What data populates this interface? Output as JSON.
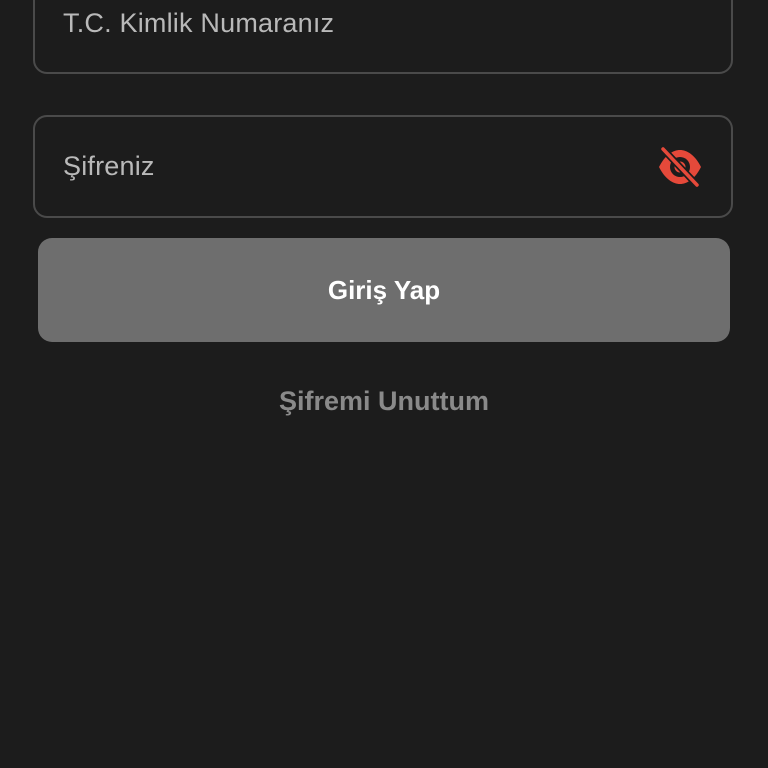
{
  "form": {
    "tc_field": {
      "placeholder": "T.C. Kimlik Numaranız"
    },
    "password_field": {
      "placeholder": "Şifreniz",
      "visibility_icon": "eye-off-icon",
      "visibility_icon_color": "#e5493a"
    },
    "login_button": {
      "label": "Giriş Yap",
      "background": "#6e6e6e"
    },
    "forgot_password": {
      "label": "Şifremi Unuttum"
    }
  },
  "theme": {
    "background": "#1c1c1c",
    "border": "#4a4a4a"
  }
}
